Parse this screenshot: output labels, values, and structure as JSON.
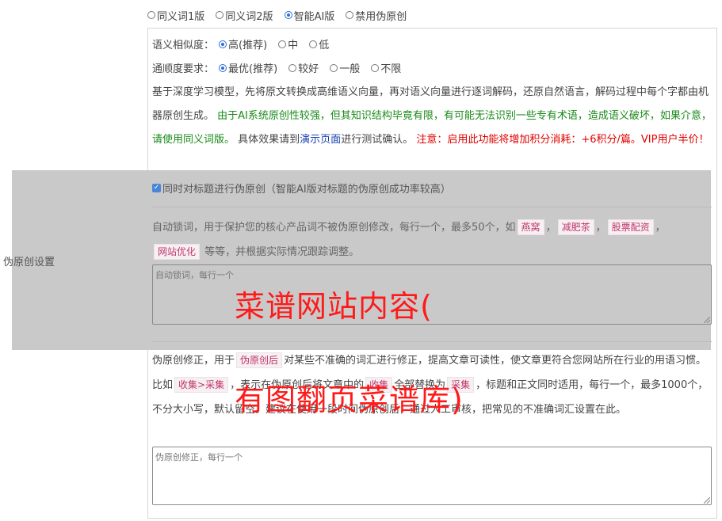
{
  "mode_options": [
    {
      "label": "同义词1版",
      "selected": false
    },
    {
      "label": "同义词2版",
      "selected": false
    },
    {
      "label": "智能AI版",
      "selected": true
    },
    {
      "label": "禁用伪原创",
      "selected": false
    }
  ],
  "similarity": {
    "label": "语义相似度：",
    "options": [
      {
        "label": "高(推荐)",
        "selected": true
      },
      {
        "label": "中",
        "selected": false
      },
      {
        "label": "低",
        "selected": false
      }
    ]
  },
  "fluency": {
    "label": "通顺度要求：",
    "options": [
      {
        "label": "最优(推荐)",
        "selected": true
      },
      {
        "label": "较好",
        "selected": false
      },
      {
        "label": "一般",
        "selected": false
      },
      {
        "label": "不限",
        "selected": false
      }
    ]
  },
  "description": {
    "part1": "基于深度学习模型，先将原文转换成高维语义向量，再对语义向量进行逐词解码，还原自然语言，解码过程中每个字都由机器原创生成。",
    "part2_green": "由于AI系统原创性较强，但其知识结构毕竟有限，有可能无法识别一些专有术语，造成语义破坏，如果介意，请使用同义词版。",
    "part3": "具体效果请到",
    "demo_link": "演示页面",
    "part4": "进行测试确认。",
    "note_red": "注意：启用此功能将增加积分消耗：+6积分/篇。VIP用户半价！"
  },
  "side_label": "伪原创设置",
  "title_checkbox": {
    "label": "同时对标题进行伪原创（智能AI版对标题的伪原创成功率较高）",
    "checked": true
  },
  "lock": {
    "desc_a": "自动锁词，用于保护您的核心产品词不被伪原创修改，每行一个，最多50个，如",
    "tags": [
      "燕窝",
      "减肥茶",
      "股票配资",
      "网站优化"
    ],
    "desc_b": "等等，并根据实际情况跟踪调整。",
    "placeholder": "自动锁词，每行一个"
  },
  "fix": {
    "desc_a": "伪原创修正，用于",
    "tag1": "伪原创后",
    "desc_b": "对某些不准确的词汇进行修正，提高文章可读性，使文章更符合您网站所在行业的用语习惯。比如",
    "tag2": "收集>采集",
    "desc_c": "，表示在伪原创后将文章中的",
    "tag3": "收集",
    "desc_d": "全部替换为",
    "tag4": "采集",
    "desc_e": "，标题和正文同时适用，每行一个，最多1000个，不分大小写，默认留空。建议在使用一段时间伪原创后，通过人工审核，把常见的不准确词汇设置在此。",
    "placeholder": "伪原创修正，每行一个"
  },
  "watermark": {
    "line1": "菜谱网站内容(",
    "line2": "有图翻页菜谱库)"
  },
  "colors": {
    "accent": "#2a6fd6",
    "green": "#1a8a1a",
    "red": "#e00000",
    "link": "#1a3fb0",
    "overlay": "#c9c9c9",
    "watermark": "#ff1a1a"
  }
}
